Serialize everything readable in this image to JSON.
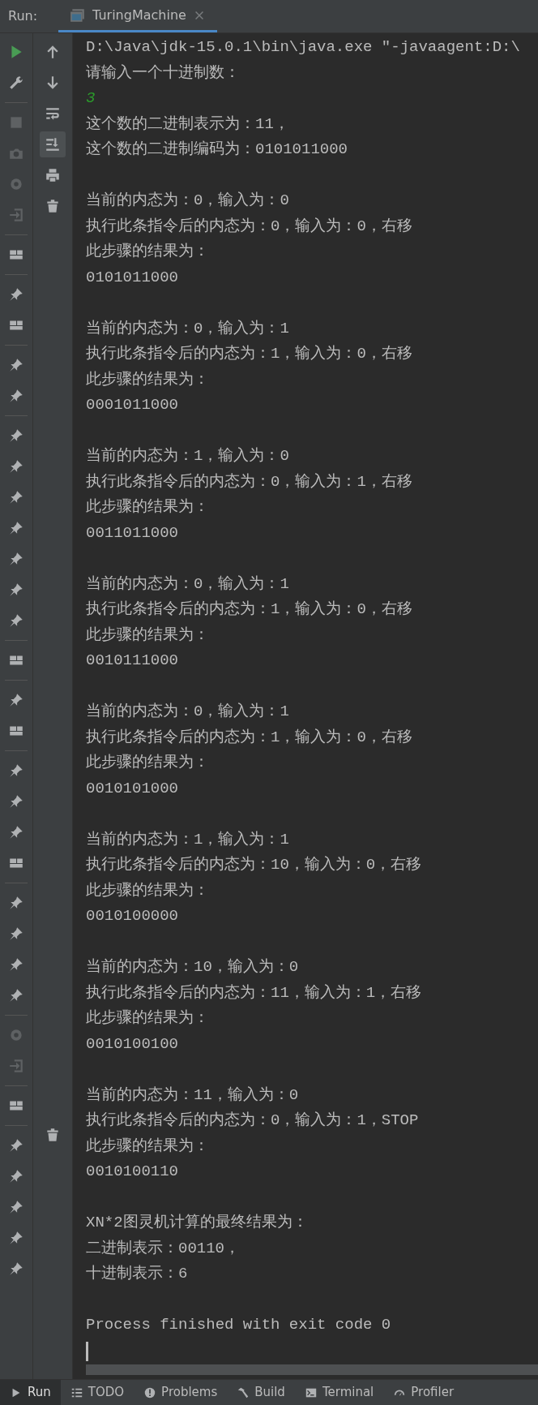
{
  "run_panel": {
    "label": "Run:"
  },
  "tabs": [
    {
      "label": "TuringMachine",
      "selected": true
    }
  ],
  "console": {
    "lines": [
      {
        "kind": "output",
        "text": "D:\\Java\\jdk-15.0.1\\bin\\java.exe \"-javaagent:D:\\"
      },
      {
        "kind": "output",
        "text": "请输入一个十进制数："
      },
      {
        "kind": "input",
        "text": "3"
      },
      {
        "kind": "output",
        "text": "这个数的二进制表示为：11，"
      },
      {
        "kind": "output",
        "text": "这个数的二进制编码为：0101011000"
      },
      {
        "kind": "blank"
      },
      {
        "kind": "output",
        "text": "当前的内态为：0，输入为：0"
      },
      {
        "kind": "output",
        "text": "执行此条指令后的内态为：0，输入为：0，右移"
      },
      {
        "kind": "output",
        "text": "此步骤的结果为："
      },
      {
        "kind": "output",
        "text": "0101011000"
      },
      {
        "kind": "blank"
      },
      {
        "kind": "output",
        "text": "当前的内态为：0，输入为：1"
      },
      {
        "kind": "output",
        "text": "执行此条指令后的内态为：1，输入为：0，右移"
      },
      {
        "kind": "output",
        "text": "此步骤的结果为："
      },
      {
        "kind": "output",
        "text": "0001011000"
      },
      {
        "kind": "blank"
      },
      {
        "kind": "output",
        "text": "当前的内态为：1，输入为：0"
      },
      {
        "kind": "output",
        "text": "执行此条指令后的内态为：0，输入为：1，右移"
      },
      {
        "kind": "output",
        "text": "此步骤的结果为："
      },
      {
        "kind": "output",
        "text": "0011011000"
      },
      {
        "kind": "blank"
      },
      {
        "kind": "output",
        "text": "当前的内态为：0，输入为：1"
      },
      {
        "kind": "output",
        "text": "执行此条指令后的内态为：1，输入为：0，右移"
      },
      {
        "kind": "output",
        "text": "此步骤的结果为："
      },
      {
        "kind": "output",
        "text": "0010111000"
      },
      {
        "kind": "blank"
      },
      {
        "kind": "output",
        "text": "当前的内态为：0，输入为：1"
      },
      {
        "kind": "output",
        "text": "执行此条指令后的内态为：1，输入为：0，右移"
      },
      {
        "kind": "output",
        "text": "此步骤的结果为："
      },
      {
        "kind": "output",
        "text": "0010101000"
      },
      {
        "kind": "blank"
      },
      {
        "kind": "output",
        "text": "当前的内态为：1，输入为：1"
      },
      {
        "kind": "output",
        "text": "执行此条指令后的内态为：10，输入为：0，右移"
      },
      {
        "kind": "output",
        "text": "此步骤的结果为："
      },
      {
        "kind": "output",
        "text": "0010100000"
      },
      {
        "kind": "blank"
      },
      {
        "kind": "output",
        "text": "当前的内态为：10，输入为：0"
      },
      {
        "kind": "output",
        "text": "执行此条指令后的内态为：11，输入为：1，右移"
      },
      {
        "kind": "output",
        "text": "此步骤的结果为："
      },
      {
        "kind": "output",
        "text": "0010100100"
      },
      {
        "kind": "blank"
      },
      {
        "kind": "output",
        "text": "当前的内态为：11，输入为：0"
      },
      {
        "kind": "output",
        "text": "执行此条指令后的内态为：0，输入为：1，STOP"
      },
      {
        "kind": "output",
        "text": "此步骤的结果为："
      },
      {
        "kind": "output",
        "text": "0010100110"
      },
      {
        "kind": "blank"
      },
      {
        "kind": "output",
        "text": "XN*2图灵机计算的最终结果为："
      },
      {
        "kind": "output",
        "text": "二进制表示：00110，"
      },
      {
        "kind": "output",
        "text": "十进制表示：6"
      },
      {
        "kind": "blank"
      },
      {
        "kind": "output",
        "text": "Process finished with exit code 0"
      }
    ]
  },
  "bottom_tabs": [
    {
      "label": "Run",
      "selected": true
    },
    {
      "label": "TODO",
      "selected": false
    },
    {
      "label": "Problems",
      "selected": false
    },
    {
      "label": "Build",
      "selected": false
    },
    {
      "label": "Terminal",
      "selected": false
    },
    {
      "label": "Profiler",
      "selected": false
    }
  ]
}
